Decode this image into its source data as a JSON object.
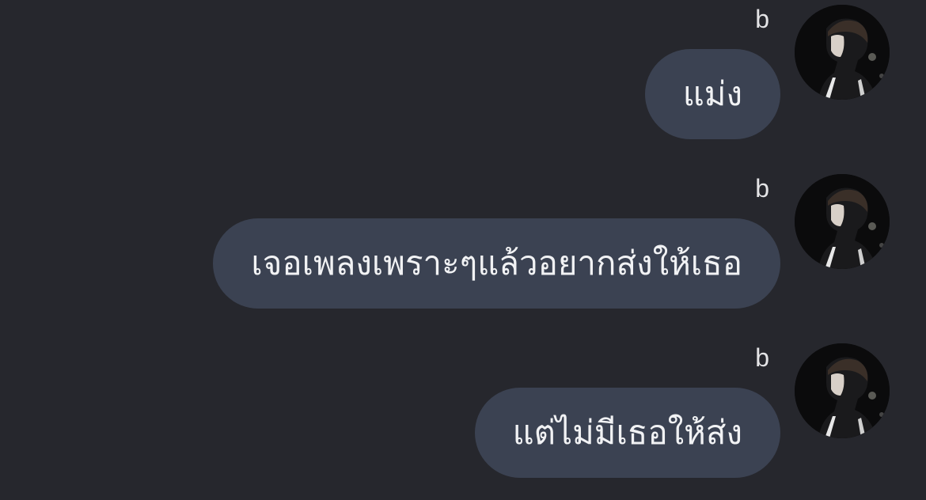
{
  "conversation": {
    "messages": [
      {
        "sender": "b",
        "text": "แม่ง"
      },
      {
        "sender": "b",
        "text": "เจอเพลงเพราะๆแล้วอยากส่งให้เธอ"
      },
      {
        "sender": "b",
        "text": "แต่ไม่มีเธอให้ส่ง"
      }
    ]
  },
  "colors": {
    "background": "#26272d",
    "bubble": "#3b4252",
    "text": "#f1f2f4"
  }
}
